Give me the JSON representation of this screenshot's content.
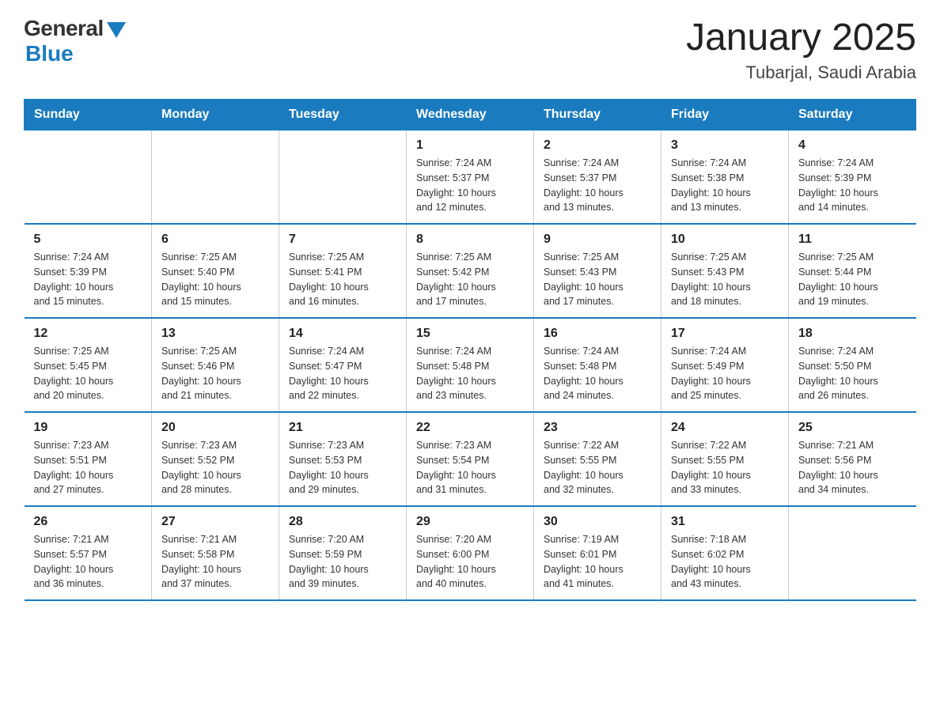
{
  "header": {
    "logo_general": "General",
    "logo_blue": "Blue",
    "main_title": "January 2025",
    "subtitle": "Tubarjal, Saudi Arabia"
  },
  "days_of_week": [
    "Sunday",
    "Monday",
    "Tuesday",
    "Wednesday",
    "Thursday",
    "Friday",
    "Saturday"
  ],
  "weeks": [
    [
      {
        "day": "",
        "info": ""
      },
      {
        "day": "",
        "info": ""
      },
      {
        "day": "",
        "info": ""
      },
      {
        "day": "1",
        "info": "Sunrise: 7:24 AM\nSunset: 5:37 PM\nDaylight: 10 hours\nand 12 minutes."
      },
      {
        "day": "2",
        "info": "Sunrise: 7:24 AM\nSunset: 5:37 PM\nDaylight: 10 hours\nand 13 minutes."
      },
      {
        "day": "3",
        "info": "Sunrise: 7:24 AM\nSunset: 5:38 PM\nDaylight: 10 hours\nand 13 minutes."
      },
      {
        "day": "4",
        "info": "Sunrise: 7:24 AM\nSunset: 5:39 PM\nDaylight: 10 hours\nand 14 minutes."
      }
    ],
    [
      {
        "day": "5",
        "info": "Sunrise: 7:24 AM\nSunset: 5:39 PM\nDaylight: 10 hours\nand 15 minutes."
      },
      {
        "day": "6",
        "info": "Sunrise: 7:25 AM\nSunset: 5:40 PM\nDaylight: 10 hours\nand 15 minutes."
      },
      {
        "day": "7",
        "info": "Sunrise: 7:25 AM\nSunset: 5:41 PM\nDaylight: 10 hours\nand 16 minutes."
      },
      {
        "day": "8",
        "info": "Sunrise: 7:25 AM\nSunset: 5:42 PM\nDaylight: 10 hours\nand 17 minutes."
      },
      {
        "day": "9",
        "info": "Sunrise: 7:25 AM\nSunset: 5:43 PM\nDaylight: 10 hours\nand 17 minutes."
      },
      {
        "day": "10",
        "info": "Sunrise: 7:25 AM\nSunset: 5:43 PM\nDaylight: 10 hours\nand 18 minutes."
      },
      {
        "day": "11",
        "info": "Sunrise: 7:25 AM\nSunset: 5:44 PM\nDaylight: 10 hours\nand 19 minutes."
      }
    ],
    [
      {
        "day": "12",
        "info": "Sunrise: 7:25 AM\nSunset: 5:45 PM\nDaylight: 10 hours\nand 20 minutes."
      },
      {
        "day": "13",
        "info": "Sunrise: 7:25 AM\nSunset: 5:46 PM\nDaylight: 10 hours\nand 21 minutes."
      },
      {
        "day": "14",
        "info": "Sunrise: 7:24 AM\nSunset: 5:47 PM\nDaylight: 10 hours\nand 22 minutes."
      },
      {
        "day": "15",
        "info": "Sunrise: 7:24 AM\nSunset: 5:48 PM\nDaylight: 10 hours\nand 23 minutes."
      },
      {
        "day": "16",
        "info": "Sunrise: 7:24 AM\nSunset: 5:48 PM\nDaylight: 10 hours\nand 24 minutes."
      },
      {
        "day": "17",
        "info": "Sunrise: 7:24 AM\nSunset: 5:49 PM\nDaylight: 10 hours\nand 25 minutes."
      },
      {
        "day": "18",
        "info": "Sunrise: 7:24 AM\nSunset: 5:50 PM\nDaylight: 10 hours\nand 26 minutes."
      }
    ],
    [
      {
        "day": "19",
        "info": "Sunrise: 7:23 AM\nSunset: 5:51 PM\nDaylight: 10 hours\nand 27 minutes."
      },
      {
        "day": "20",
        "info": "Sunrise: 7:23 AM\nSunset: 5:52 PM\nDaylight: 10 hours\nand 28 minutes."
      },
      {
        "day": "21",
        "info": "Sunrise: 7:23 AM\nSunset: 5:53 PM\nDaylight: 10 hours\nand 29 minutes."
      },
      {
        "day": "22",
        "info": "Sunrise: 7:23 AM\nSunset: 5:54 PM\nDaylight: 10 hours\nand 31 minutes."
      },
      {
        "day": "23",
        "info": "Sunrise: 7:22 AM\nSunset: 5:55 PM\nDaylight: 10 hours\nand 32 minutes."
      },
      {
        "day": "24",
        "info": "Sunrise: 7:22 AM\nSunset: 5:55 PM\nDaylight: 10 hours\nand 33 minutes."
      },
      {
        "day": "25",
        "info": "Sunrise: 7:21 AM\nSunset: 5:56 PM\nDaylight: 10 hours\nand 34 minutes."
      }
    ],
    [
      {
        "day": "26",
        "info": "Sunrise: 7:21 AM\nSunset: 5:57 PM\nDaylight: 10 hours\nand 36 minutes."
      },
      {
        "day": "27",
        "info": "Sunrise: 7:21 AM\nSunset: 5:58 PM\nDaylight: 10 hours\nand 37 minutes."
      },
      {
        "day": "28",
        "info": "Sunrise: 7:20 AM\nSunset: 5:59 PM\nDaylight: 10 hours\nand 39 minutes."
      },
      {
        "day": "29",
        "info": "Sunrise: 7:20 AM\nSunset: 6:00 PM\nDaylight: 10 hours\nand 40 minutes."
      },
      {
        "day": "30",
        "info": "Sunrise: 7:19 AM\nSunset: 6:01 PM\nDaylight: 10 hours\nand 41 minutes."
      },
      {
        "day": "31",
        "info": "Sunrise: 7:18 AM\nSunset: 6:02 PM\nDaylight: 10 hours\nand 43 minutes."
      },
      {
        "day": "",
        "info": ""
      }
    ]
  ]
}
